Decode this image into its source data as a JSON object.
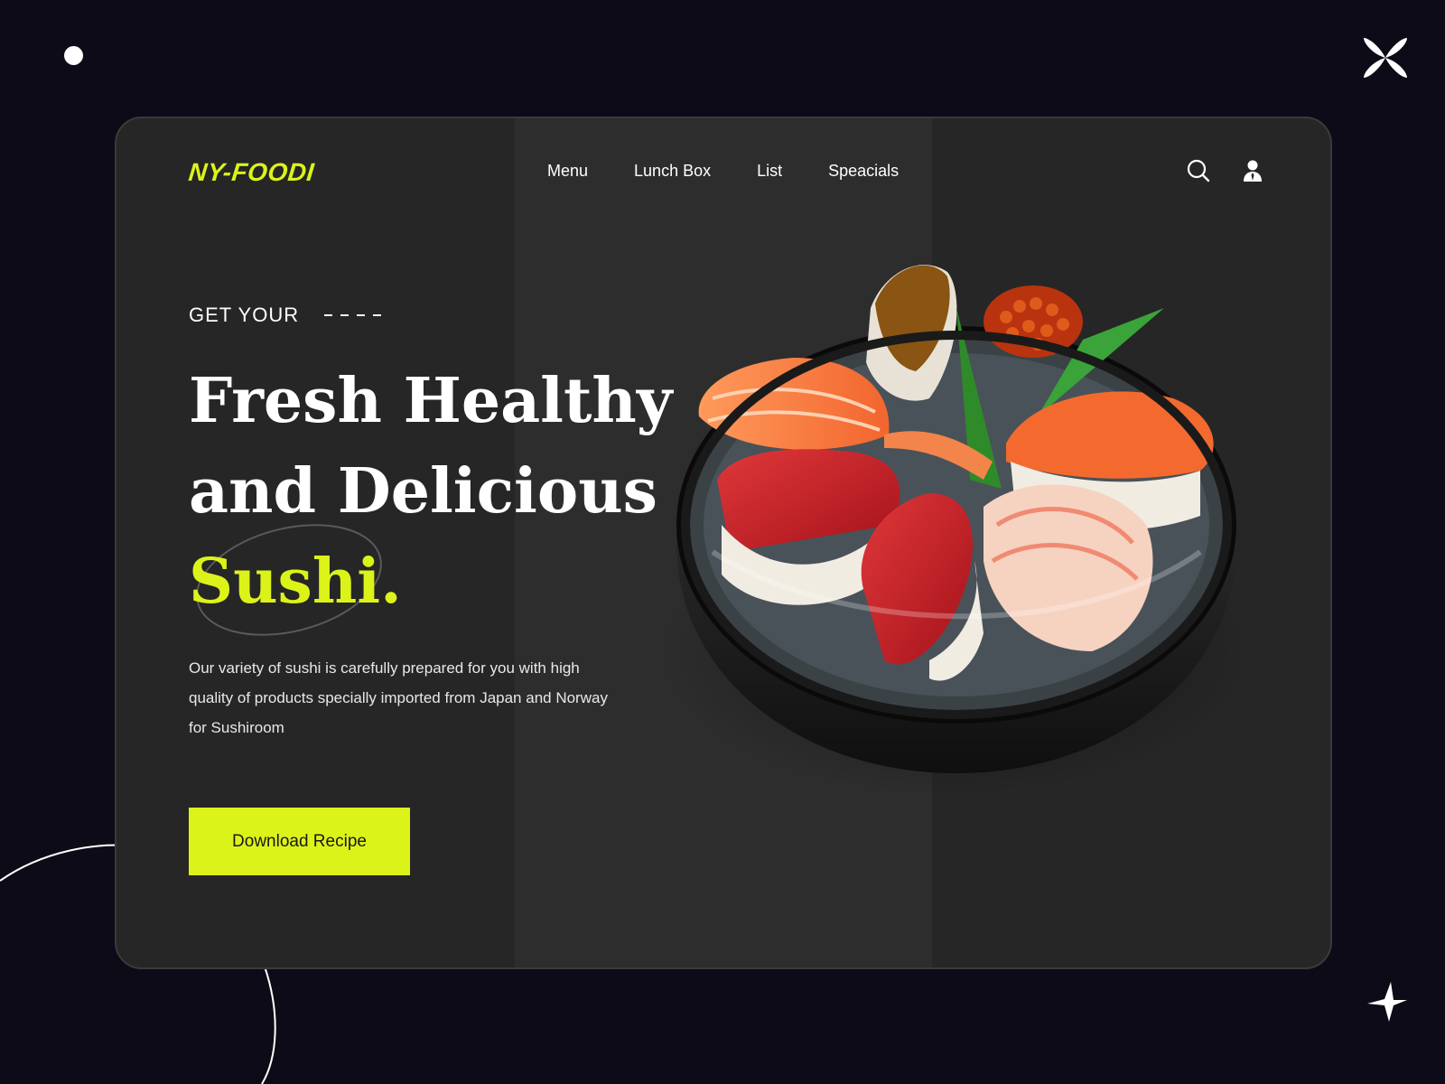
{
  "brand": {
    "logo": "NY-FOODI"
  },
  "nav": {
    "items": [
      "Menu",
      "Lunch Box",
      "List",
      "Speacials"
    ]
  },
  "header_icons": [
    "search-icon",
    "user-icon"
  ],
  "hero": {
    "eyebrow": "GET YOUR",
    "title_line1": "Fresh Healthy",
    "title_line2": "and Delicious",
    "title_accent": "Sushi.",
    "description": "Our variety of sushi is carefully prepared for you with high quality of products specially imported from Japan and Norway for Sushiroom",
    "cta_label": "Download Recipe"
  },
  "colors": {
    "accent": "#dcf31a",
    "background": "#0d0b17",
    "card": "#262626",
    "band": "#2d2d2d"
  },
  "decorations": [
    "dot",
    "flower-icon",
    "sparkle-icon",
    "curve-lines"
  ]
}
